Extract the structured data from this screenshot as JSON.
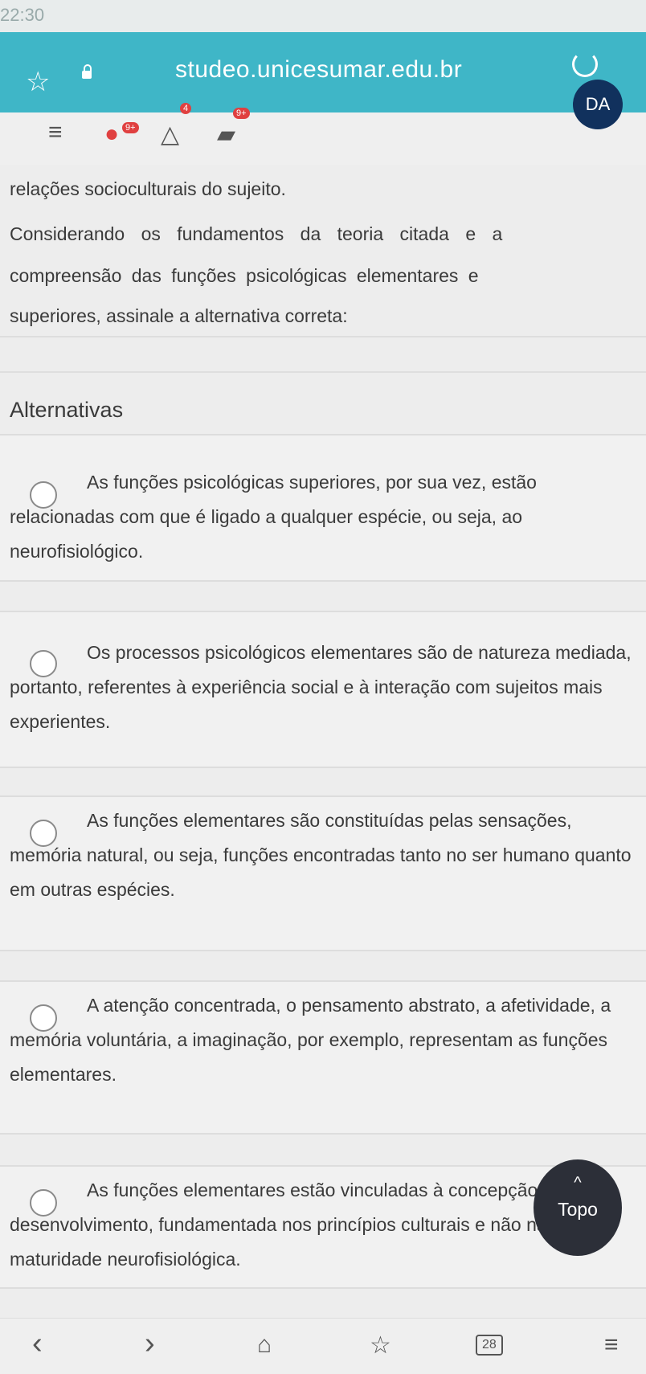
{
  "status_bar": {
    "time": "22:30"
  },
  "browser": {
    "url": "studeo.unicesumar.edu.br"
  },
  "app_bar": {
    "chat_badge": "9+",
    "notification_badge": "4",
    "doc_badge": "9+",
    "avatar_initials": "DA"
  },
  "question": {
    "partial_line": "relações socioculturais do sujeito.",
    "prompt_lines": [
      "Considerando os fundamentos da teoria citada e a",
      "compreensão das funções psicológicas elementares e",
      "superiores, assinale a alternativa correta:"
    ]
  },
  "alternatives_heading": "Alternativas",
  "alternatives": [
    {
      "text": "As funções psicológicas superiores, por sua vez, estão relacionadas com que é ligado a qualquer espécie, ou seja, ao neurofisiológico."
    },
    {
      "text": "Os processos psicológicos elementares são de natureza mediada, portanto, referentes à experiência social e à interação com sujeitos mais experientes."
    },
    {
      "text": "As funções elementares são constituídas pelas sensações, memória natural, ou seja, funções encontradas tanto no ser humano quanto em outras espécies."
    },
    {
      "text": "A atenção concentrada, o pensamento abstrato, a afetividade, a memória voluntária, a imaginação, por exemplo, representam as funções elementares."
    },
    {
      "text": "As funções elementares estão vinculadas à concepção social do desenvolvimento, fundamentada nos princípios culturais e não na maturidade neurofisiológica."
    }
  ],
  "topo_button": {
    "label": "Topo"
  },
  "bottom_nav": {
    "tabs_count": "28"
  }
}
